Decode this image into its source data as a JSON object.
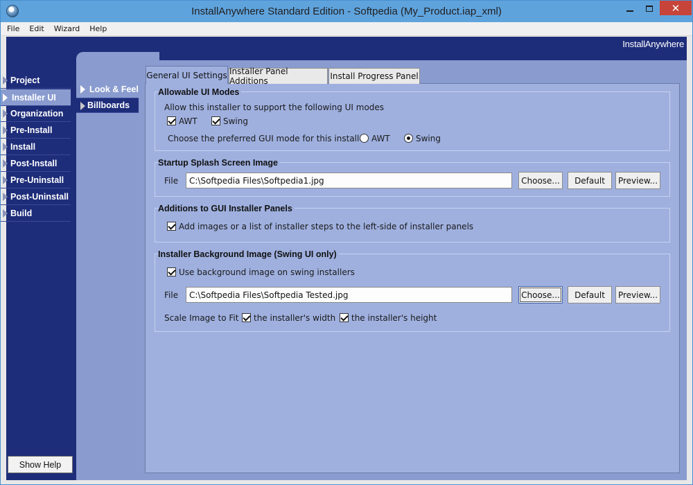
{
  "window": {
    "title": "InstallAnywhere Standard Edition - Softpedia (My_Product.iap_xml)",
    "close_glyph": "✕"
  },
  "menu": [
    "File",
    "Edit",
    "Wizard",
    "Help"
  ],
  "brand": "InstallAnywhere",
  "nav": [
    {
      "label": "Project",
      "active": false
    },
    {
      "label": "Installer UI",
      "active": true
    },
    {
      "label": "Organization",
      "active": false
    },
    {
      "label": "Pre-Install",
      "active": false
    },
    {
      "label": "Install",
      "active": false
    },
    {
      "label": "Post-Install",
      "active": false
    },
    {
      "label": "Pre-Uninstall",
      "active": false
    },
    {
      "label": "Post-Uninstall",
      "active": false
    },
    {
      "label": "Build",
      "active": false
    }
  ],
  "show_help_label": "Show Help",
  "subnav": [
    {
      "label": "Look & Feel",
      "active": true
    },
    {
      "label": "Billboards",
      "active": false
    }
  ],
  "tabs": [
    {
      "label": "General UI Settings",
      "selected": true
    },
    {
      "label": "Installer Panel Additions",
      "selected": false
    },
    {
      "label": "Install Progress Panel",
      "selected": false
    }
  ],
  "ui_modes": {
    "title": "Allowable UI Modes",
    "description": "Allow this installer to support the following UI modes",
    "awt_label": "AWT",
    "awt_checked": true,
    "swing_label": "Swing",
    "swing_checked": true,
    "preferred_label": "Choose the preferred GUI mode for this installer",
    "radio_awt_label": "AWT",
    "radio_swing_label": "Swing",
    "preferred_value": "Swing"
  },
  "splash": {
    "title": "Startup Splash Screen Image",
    "file_label": "File",
    "file_value": "C:\\Softpedia Files\\Softpedia1.jpg",
    "choose_label": "Choose...",
    "default_label": "Default",
    "preview_label": "Preview..."
  },
  "additions": {
    "title": "Additions to GUI Installer Panels",
    "checkbox_label": "Add images or a list of installer steps to the left-side of installer panels",
    "checked": true
  },
  "background": {
    "title": "Installer Background Image (Swing UI only)",
    "use_label": "Use background image on swing installers",
    "use_checked": true,
    "file_label": "File",
    "file_value": "C:\\Softpedia Files\\Softpedia Tested.jpg",
    "choose_label": "Choose...",
    "default_label": "Default",
    "preview_label": "Preview...",
    "scale_label": "Scale Image to Fit",
    "width_label": "the installer's width",
    "width_checked": true,
    "height_label": "the installer's height",
    "height_checked": true
  }
}
